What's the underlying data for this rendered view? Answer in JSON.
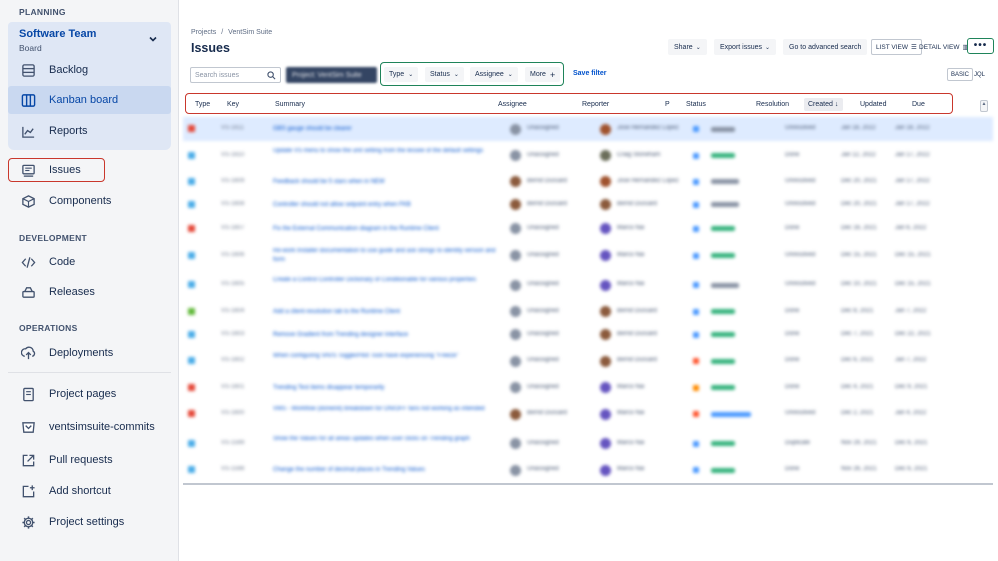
{
  "sidebar": {
    "sections": {
      "planning": "PLANNING",
      "development": "DEVELOPMENT",
      "operations": "OPERATIONS"
    },
    "project": {
      "name": "Software Team",
      "subtitle": "Board"
    },
    "items": [
      {
        "label": "Backlog",
        "icon": "backlog-icon"
      },
      {
        "label": "Kanban board",
        "icon": "board-columns-icon"
      },
      {
        "label": "Reports",
        "icon": "chart-line-icon"
      },
      {
        "label": "Issues",
        "icon": "issues-icon"
      },
      {
        "label": "Components",
        "icon": "components-icon"
      },
      {
        "label": "Code",
        "icon": "code-icon"
      },
      {
        "label": "Releases",
        "icon": "releases-icon"
      },
      {
        "label": "Deployments",
        "icon": "deployments-icon"
      },
      {
        "label": "Project pages",
        "icon": "page-icon"
      },
      {
        "label": "ventsimsuite-commits",
        "icon": "repository-icon"
      },
      {
        "label": "Pull requests",
        "icon": "external-link-icon"
      },
      {
        "label": "Add shortcut",
        "icon": "add-shortcut-icon"
      },
      {
        "label": "Project settings",
        "icon": "gear-icon"
      }
    ]
  },
  "header": {
    "breadcrumb": {
      "root": "Projects",
      "separator": "/",
      "project": "VentSim Suite"
    },
    "title": "Issues",
    "share_label": "Share",
    "export_label": "Export issues",
    "advanced_search_label": "Go to advanced search",
    "list_view_label": "LIST VIEW",
    "detail_view_label": "DETAIL VIEW",
    "more_label": "•••"
  },
  "filters": {
    "search_placeholder": "Search issues",
    "project_filter": "Project: VentSim Suite",
    "type": "Type",
    "status": "Status",
    "assignee": "Assignee",
    "more": "More",
    "save_filter": "Save filter",
    "basic": "BASIC",
    "jql": "JQL"
  },
  "table": {
    "columns": {
      "type": "Type",
      "key": "Key",
      "summary": "Summary",
      "assignee": "Assignee",
      "reporter": "Reporter",
      "priority": "P",
      "status": "Status",
      "resolution": "Resolution",
      "created": "Created",
      "updated": "Updated",
      "due": "Due"
    },
    "sort_indicator": "↓",
    "rows": [
      {
        "type": "bug",
        "key": "VS-1611",
        "summary": "GBS gauge should be clearer",
        "assignee": "Unassigned",
        "reporter": "Jose Hernandez Lopez",
        "status": "NEW",
        "resolution": "Unresolved",
        "created": "Jan 18, 2022",
        "updated": "Jan 18, 2022",
        "selected": true,
        "typeColor": "#e5493a",
        "assigneeAv": "#8993a4",
        "reporterAv": "#a0522d",
        "priColor": "#4c9aff",
        "statusColor": "#8993a4",
        "statusW": 24
      },
      {
        "type": "task",
        "key": "VS-1610",
        "summary": "Update VS menu to show the unit setting from the lessee of the default settings",
        "assignee": "Unassigned",
        "reporter": "Craig Stoneham",
        "status": "DONE",
        "resolution": "Done",
        "created": "Jan 12, 2022",
        "updated": "Jan 17, 2022",
        "typeColor": "#4bade8",
        "assigneeAv": "#8993a4",
        "reporterAv": "#6b6e5a",
        "priColor": "#4c9aff",
        "statusColor": "#36b37e",
        "statusW": 24,
        "twoLine": true
      },
      {
        "type": "task",
        "key": "VS-1609",
        "summary": "Feedback should be 5 stars when in NEW",
        "assignee": "Bernd Dussard",
        "reporter": "Jose Hernandez Lopez",
        "status": "REVIEW",
        "resolution": "Unresolved",
        "created": "Dec 20, 2021",
        "updated": "Jan 17, 2022",
        "typeColor": "#4bade8",
        "assigneeAv": "#8b5a3c",
        "reporterAv": "#a0522d",
        "priColor": "#4c9aff",
        "statusColor": "#8993a4",
        "statusW": 28
      },
      {
        "type": "task",
        "key": "VS-1608",
        "summary": "Controller should not allow setpoint entry when FKB",
        "assignee": "Bernd Dussard",
        "reporter": "Bernd Dussard",
        "status": "REVIEW",
        "resolution": "Unresolved",
        "created": "Dec 20, 2021",
        "updated": "Jan 17, 2022",
        "typeColor": "#4bade8",
        "assigneeAv": "#8b5a3c",
        "reporterAv": "#8b5a3c",
        "priColor": "#4c9aff",
        "statusColor": "#8993a4",
        "statusW": 28
      },
      {
        "type": "bug",
        "key": "VS-1607",
        "summary": "Fix the External Communication diagram in the Runtime Client",
        "assignee": "Unassigned",
        "reporter": "Marco Nai",
        "status": "DONE",
        "resolution": "Done",
        "created": "Dec 16, 2021",
        "updated": "Jan 6, 2022",
        "typeColor": "#e5493a",
        "assigneeAv": "#8993a4",
        "reporterAv": "#6554c0",
        "priColor": "#4c9aff",
        "statusColor": "#36b37e",
        "statusW": 24
      },
      {
        "type": "task",
        "key": "VS-1606",
        "summary": "Re-work Installer documentation to use guide and ask strings to identify version and form",
        "assignee": "Unassigned",
        "reporter": "Marco Nai",
        "status": "DONE",
        "resolution": "Unresolved",
        "created": "Dec 15, 2021",
        "updated": "Dec 15, 2021",
        "typeColor": "#4bade8",
        "assigneeAv": "#8993a4",
        "reporterAv": "#6554c0",
        "priColor": "#4c9aff",
        "statusColor": "#36b37e",
        "statusW": 24,
        "twoLine": true
      },
      {
        "type": "task",
        "key": "VS-1605",
        "summary": "Create a Control Controller Dictionary of Conditionable for various properties",
        "assignee": "Unassigned",
        "reporter": "Marco Nai",
        "status": "REVIEW",
        "resolution": "Unresolved",
        "created": "Dec 10, 2021",
        "updated": "Dec 15, 2021",
        "typeColor": "#4bade8",
        "assigneeAv": "#8993a4",
        "reporterAv": "#6554c0",
        "priColor": "#4c9aff",
        "statusColor": "#8993a4",
        "statusW": 28,
        "twoLine": true
      },
      {
        "type": "story",
        "key": "VS-1604",
        "summary": "Add a client-resolution tab to the Runtime Client",
        "assignee": "Unassigned",
        "reporter": "Bernd Dussard",
        "status": "DONE",
        "resolution": "Done",
        "created": "Dec 8, 2021",
        "updated": "Jan 7, 2022",
        "typeColor": "#63ba3c",
        "assigneeAv": "#8993a4",
        "reporterAv": "#8b5a3c",
        "priColor": "#4c9aff",
        "statusColor": "#36b37e",
        "statusW": 24
      },
      {
        "type": "task",
        "key": "VS-1603",
        "summary": "Remove Gradient from Trending designer interface",
        "assignee": "Unassigned",
        "reporter": "Bernd Dussard",
        "status": "DONE",
        "resolution": "Done",
        "created": "Dec 7, 2021",
        "updated": "Dec 22, 2021",
        "typeColor": "#4bade8",
        "assigneeAv": "#8993a4",
        "reporterAv": "#8b5a3c",
        "priColor": "#4c9aff",
        "statusColor": "#36b37e",
        "statusW": 24
      },
      {
        "type": "task",
        "key": "VS-1602",
        "summary": "When configuring VAVS Toggle/Pilot Toon have experiencing \"Freeze\"",
        "assignee": "Unassigned",
        "reporter": "Bernd Dussard",
        "status": "DONE",
        "resolution": "Done",
        "created": "Dec 6, 2021",
        "updated": "Jan 7, 2022",
        "typeColor": "#4bade8",
        "assigneeAv": "#8993a4",
        "reporterAv": "#8b5a3c",
        "priColor": "#ff5630",
        "statusColor": "#36b37e",
        "statusW": 24,
        "twoLine": true
      },
      {
        "type": "bug",
        "key": "VS-1601",
        "summary": "Trending Test items disappear temporarily",
        "assignee": "Unassigned",
        "reporter": "Marco Nai",
        "status": "DONE",
        "resolution": "Done",
        "created": "Dec 4, 2021",
        "updated": "Dec 9, 2021",
        "typeColor": "#e5493a",
        "assigneeAv": "#8993a4",
        "reporterAv": "#6554c0",
        "priColor": "#ff8b00",
        "statusColor": "#36b37e",
        "statusW": 24
      },
      {
        "type": "bug",
        "key": "VS-1600",
        "summary": "VMS - Workflow (doneinit) breakdown for ON/OFF fans not working as intended",
        "assignee": "Bernd Dussard",
        "reporter": "Marco Nai",
        "status": "IN PROGRESS",
        "resolution": "Unresolved",
        "created": "Dec 2, 2021",
        "updated": "Jan 4, 2022",
        "typeColor": "#e5493a",
        "assigneeAv": "#8b5a3c",
        "reporterAv": "#6554c0",
        "priColor": "#ff5630",
        "statusColor": "#4c9aff",
        "statusW": 40,
        "twoLine": true
      },
      {
        "type": "task",
        "key": "VS-1599",
        "summary": "Show the Values for all areas updates when user clicks on Trending graph",
        "assignee": "Unassigned",
        "reporter": "Marco Nai",
        "status": "DONE",
        "resolution": "Duplicate",
        "created": "Nov 29, 2021",
        "updated": "Dec 6, 2021",
        "typeColor": "#4bade8",
        "assigneeAv": "#8993a4",
        "reporterAv": "#6554c0",
        "priColor": "#4c9aff",
        "statusColor": "#36b37e",
        "statusW": 24,
        "twoLine": true
      },
      {
        "type": "task",
        "key": "VS-1598",
        "summary": "Change the number of decimal places in Trending Values",
        "assignee": "Unassigned",
        "reporter": "Marco Nai",
        "status": "DONE",
        "resolution": "Done",
        "created": "Nov 26, 2021",
        "updated": "Dec 6, 2021",
        "typeColor": "#4bade8",
        "assigneeAv": "#8993a4",
        "reporterAv": "#6554c0",
        "priColor": "#4c9aff",
        "statusColor": "#36b37e",
        "statusW": 24
      }
    ]
  }
}
